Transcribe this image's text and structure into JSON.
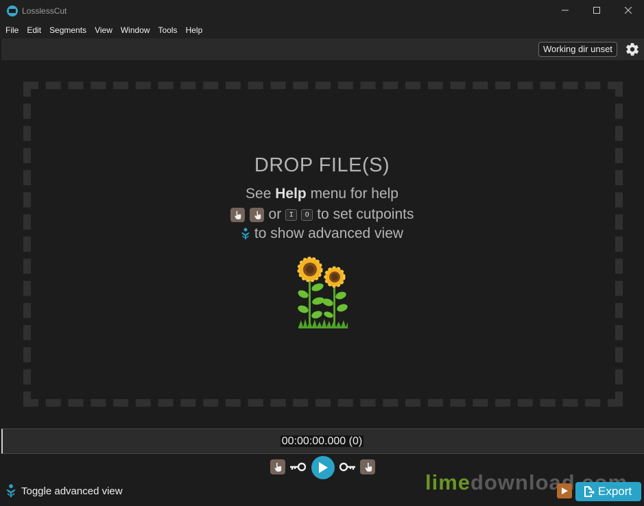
{
  "window": {
    "title": "LosslessCut"
  },
  "menu": {
    "items": [
      "File",
      "Edit",
      "Segments",
      "View",
      "Window",
      "Tools",
      "Help"
    ]
  },
  "toolbar": {
    "working_dir_label": "Working dir unset"
  },
  "drop_zone": {
    "title": "DROP FILE(S)",
    "help_prefix": "See ",
    "help_bold": "Help",
    "help_suffix": " menu for help",
    "or_text": "or",
    "key_in": "I",
    "key_out": "O",
    "cutpoints_text": "to set cutpoints",
    "advanced_text": "to show advanced view"
  },
  "timeline": {
    "time": "00:00:00.000 (0)"
  },
  "bottom": {
    "toggle_advanced_label": "Toggle advanced view",
    "export_label": "Export",
    "watermark_lime": "lime",
    "watermark_rest": "download.com"
  },
  "colors": {
    "accent": "#2aa3c8",
    "cut_button": "#75645a",
    "background": "#1c1c1c"
  }
}
